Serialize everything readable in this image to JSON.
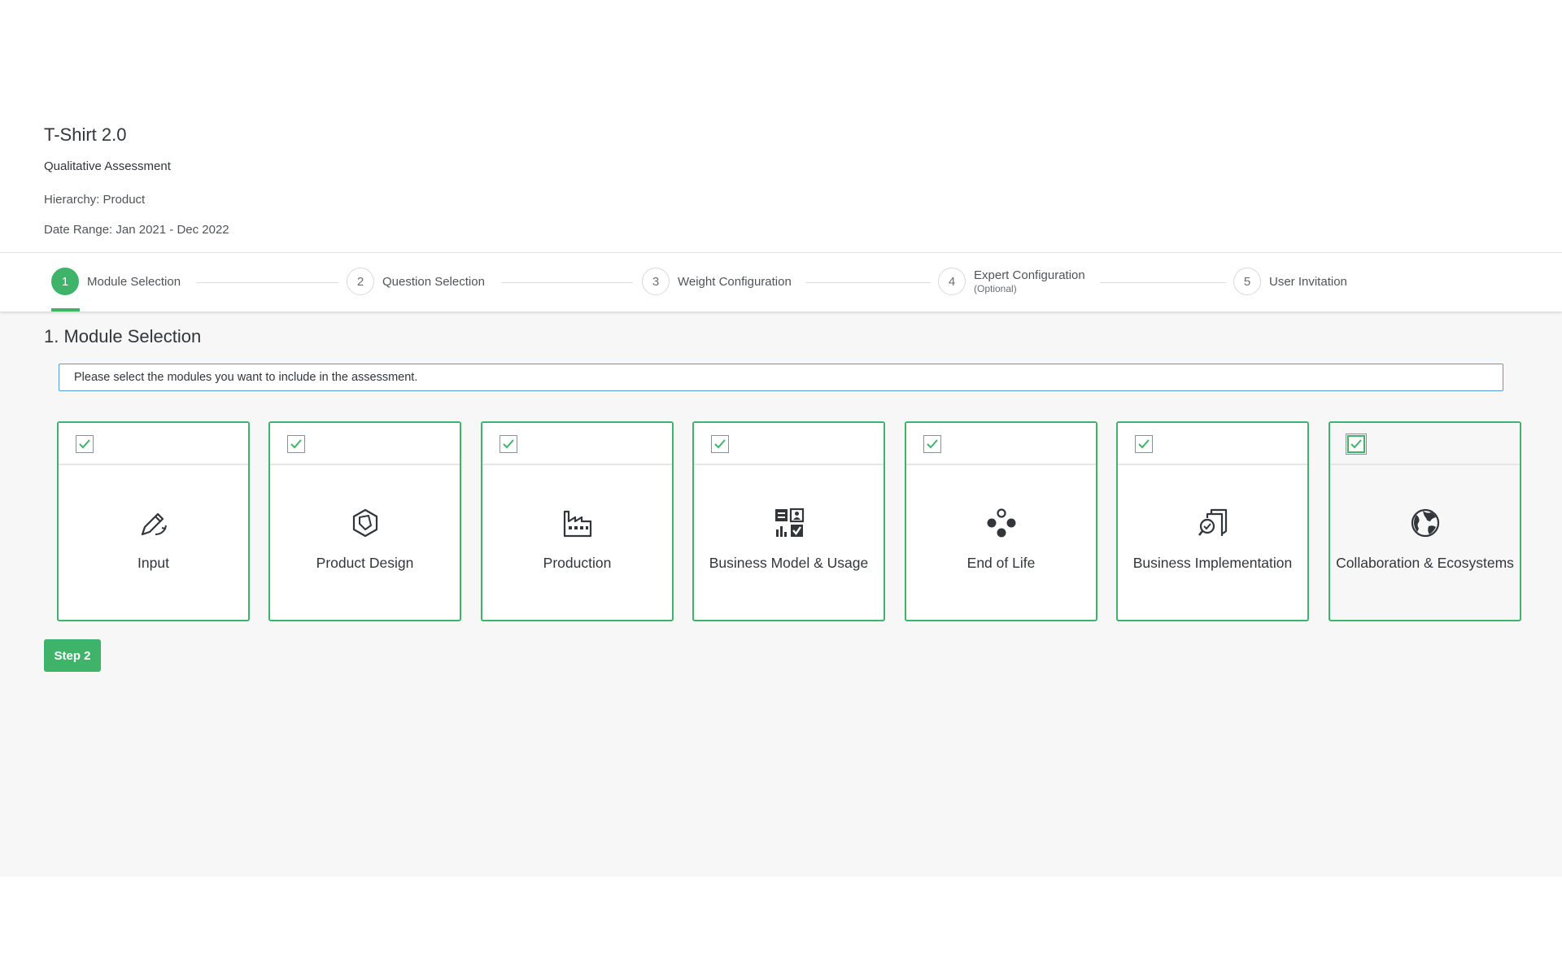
{
  "header": {
    "title": "T-Shirt 2.0",
    "subtitle": "Qualitative Assessment",
    "hierarchy": "Hierarchy: Product",
    "date_range": "Date Range: Jan 2021 - Dec 2022"
  },
  "wizard": {
    "steps": [
      {
        "number": "1",
        "label": "Module Selection",
        "active": true
      },
      {
        "number": "2",
        "label": "Question Selection"
      },
      {
        "number": "3",
        "label": "Weight Configuration"
      },
      {
        "number": "4",
        "label": "Expert Configuration",
        "sublabel": "(Optional)"
      },
      {
        "number": "5",
        "label": "User Invitation"
      }
    ]
  },
  "main": {
    "section_title": "1. Module Selection",
    "info_text": "Please select the modules you want to include in the assessment.",
    "modules": [
      {
        "label": "Input",
        "icon": "pencil-icon",
        "checked": true
      },
      {
        "label": "Product Design",
        "icon": "hexagon-box-icon",
        "checked": true
      },
      {
        "label": "Production",
        "icon": "factory-icon",
        "checked": true
      },
      {
        "label": "Business Model & Usage",
        "icon": "business-card-icon",
        "checked": true
      },
      {
        "label": "End of Life",
        "icon": "dots-cluster-icon",
        "checked": true
      },
      {
        "label": "Business Implementation",
        "icon": "document-search-icon",
        "checked": true
      },
      {
        "label": "Collaboration & Ecosystems",
        "icon": "globe-icon",
        "checked": true
      }
    ],
    "next_button": "Step 2"
  },
  "colors": {
    "accent": "#3fb36a",
    "info_border": "#5899da",
    "content_bg": "#f7f7f7"
  }
}
